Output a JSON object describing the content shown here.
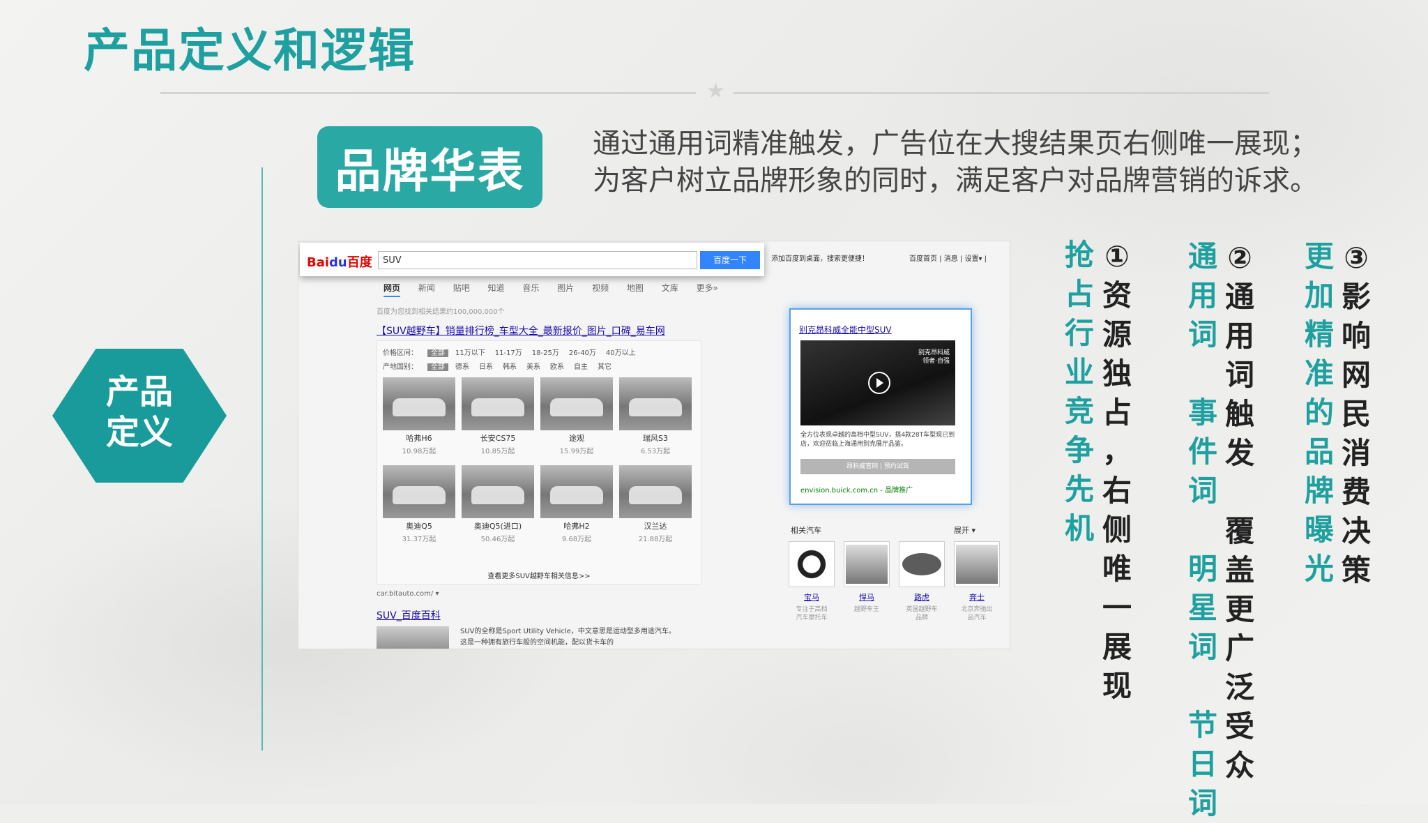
{
  "page": {
    "title": "产品定义和逻辑",
    "side_label": "产品\n定义",
    "badge": "品牌华表",
    "description_line1": "通过通用词精准触发，广告位在大搜结果页右侧唯一展现；",
    "description_line2": "为客户树立品牌形象的同时，满足客户对品牌营销的诉求。"
  },
  "screenshot": {
    "logo_text": "Bai",
    "logo_du": "du",
    "logo_cn": "百度",
    "search_value": "SUV",
    "search_button": "百度一下",
    "top_links": "添加百度到桌面，搜索更便捷！",
    "top_right": "百度首页  |  消息  |  设置▾  |",
    "nav": [
      "网页",
      "新闻",
      "贴吧",
      "知道",
      "音乐",
      "图片",
      "视频",
      "地图",
      "文库",
      "更多»"
    ],
    "found_text": "百度为您找到相关结果约100,000,000个",
    "result_title": "【SUV越野车】销量排行榜_车型大全_最新报价_图片_口碑_易车网",
    "price_filter_label": "价格区间：",
    "price_filter": [
      "全部",
      "11万以下",
      "11-17万",
      "18-25万",
      "26-40万",
      "40万以上"
    ],
    "origin_filter_label": "产地国别：",
    "origin_filter": [
      "全部",
      "德系",
      "日系",
      "韩系",
      "美系",
      "欧系",
      "自主",
      "其它"
    ],
    "cars": [
      {
        "name": "哈弗H6",
        "price": "10.98万起"
      },
      {
        "name": "长安CS75",
        "price": "10.85万起"
      },
      {
        "name": "途观",
        "price": "15.99万起"
      },
      {
        "name": "瑞风S3",
        "price": "6.53万起"
      },
      {
        "name": "奥迪Q5",
        "price": "31.37万起"
      },
      {
        "name": "奥迪Q5(进口)",
        "price": "50.46万起"
      },
      {
        "name": "哈弗H2",
        "price": "9.68万起"
      },
      {
        "name": "汉兰达",
        "price": "21.88万起"
      }
    ],
    "more_link": "查看更多SUV越野车相关信息>>",
    "site_url": "car.bitauto.com/  ▾",
    "baike_title": "SUV_百度百科",
    "baike_line1": "SUV的全称是Sport Utility Vehicle，中文意思是运动型多用途汽车。",
    "baike_line2": "这是一种拥有旅行车般的空间机能，配以货卡车的",
    "ad": {
      "title": "别克昂科威全能中型SUV",
      "video_text": "别克昂科威\n领者·自强",
      "desc": "全方位表现卓越的高档中型SUV，搭4款28T车型现已到店，欢迎莅临上海通用别克展厅品鉴。",
      "buttons": "昂科威官网    |    预约试驾",
      "url": "envision.buick.com.cn - 品牌推广"
    },
    "related": {
      "head": "相关汽车",
      "more": "展开 ▾",
      "items": [
        {
          "name": "宝马",
          "desc": "专注于高档\n汽车摩托车"
        },
        {
          "name": "悍马",
          "desc": "越野车王"
        },
        {
          "name": "路虎",
          "desc": "英国越野车\n品牌"
        },
        {
          "name": "奔士",
          "desc": "北京奔驰出\n品汽车"
        }
      ]
    }
  },
  "points": [
    {
      "num": "①",
      "teal": "抢占行业竞争先机",
      "dark": "资源独占，右侧唯一展现"
    },
    {
      "num": "②",
      "teal": "通用词 事件词 明星词 节日词",
      "dark": "通用词触发 覆盖更广泛受众"
    },
    {
      "num": "③",
      "teal": "更加精准的品牌曝光",
      "dark": "影响网民消费决策"
    }
  ],
  "colors": {
    "teal": "#1fa0a0",
    "badge": "#2aa8a4",
    "hexagon": "#1a9b9b"
  }
}
